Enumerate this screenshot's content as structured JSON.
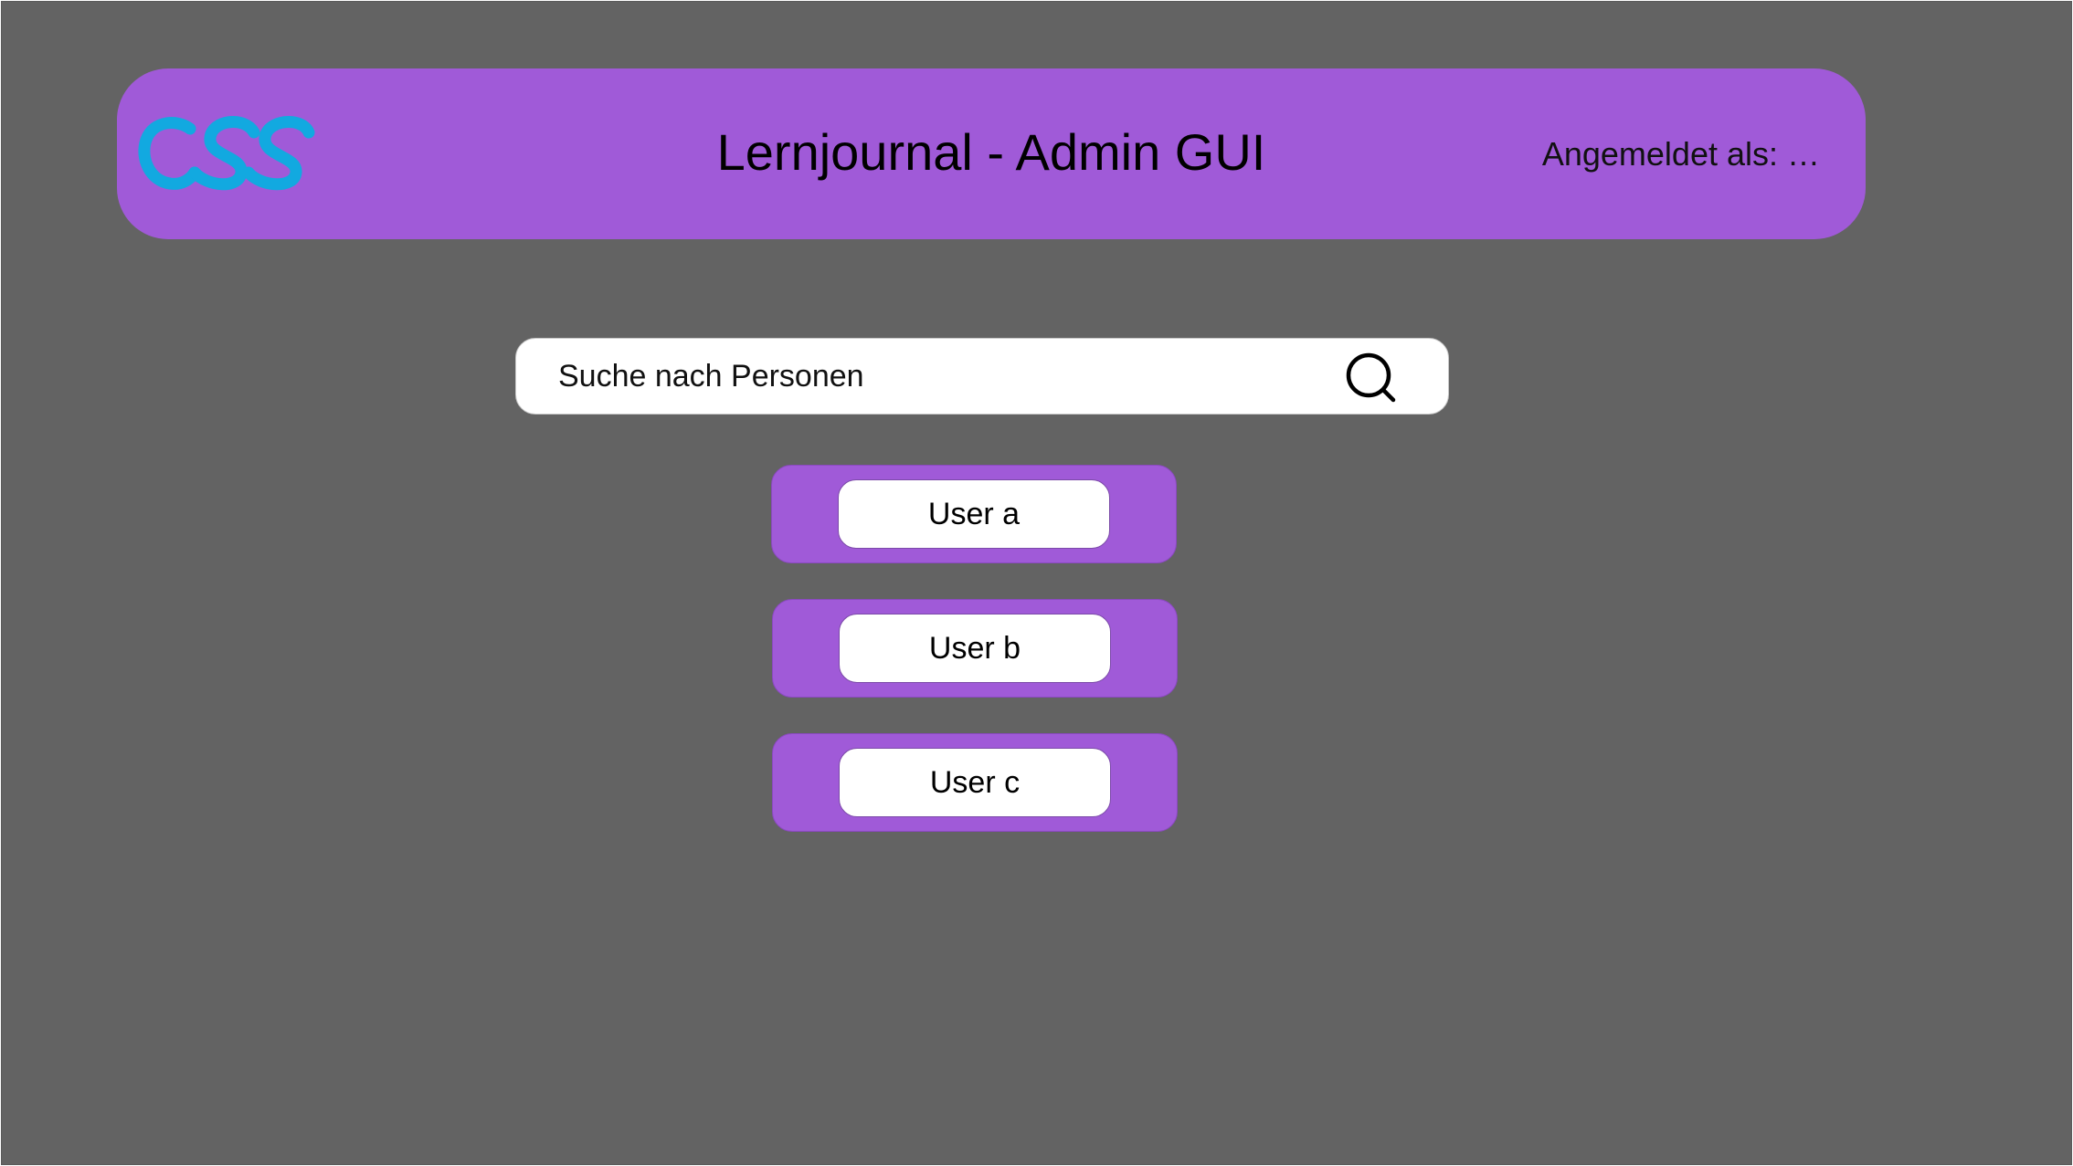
{
  "header": {
    "logo_text": "CSS",
    "title": "Lernjournal - Admin GUI",
    "login_status": "Angemeldet als: …"
  },
  "search": {
    "placeholder": "Suche nach Personen",
    "icon": "search-icon"
  },
  "users": [
    {
      "label": "User a"
    },
    {
      "label": "User b"
    },
    {
      "label": "User c"
    }
  ],
  "colors": {
    "background": "#636363",
    "accent": "#a05ad8",
    "logo": "#12a9e0",
    "surface": "#ffffff"
  }
}
